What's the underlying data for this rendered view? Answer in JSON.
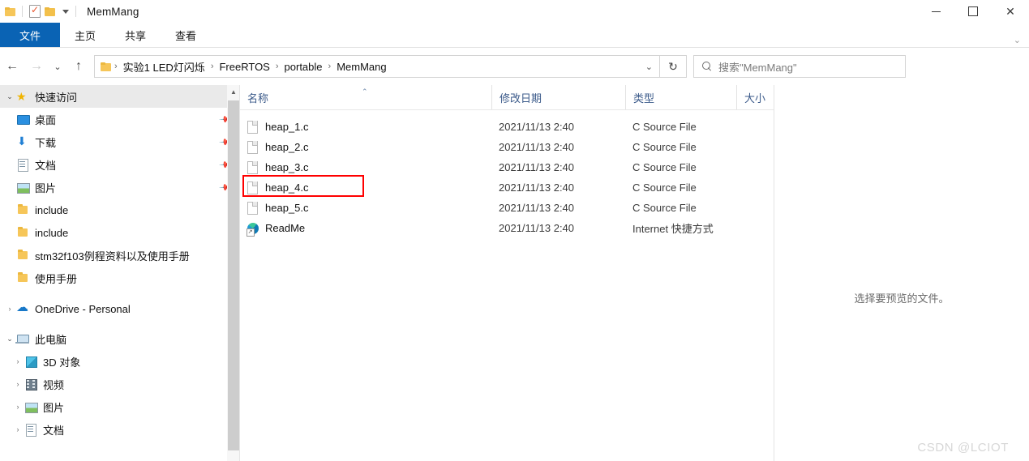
{
  "window": {
    "title": "MemMang",
    "controls": {
      "minimize": "—",
      "maximize": "▢",
      "close": "✕"
    },
    "quick_access": {
      "folder_icon": "folder-icon",
      "properties_icon": "properties-checkbox-icon",
      "new_folder_icon": "new-folder-icon",
      "dropdown_icon": "chevron-down-icon"
    }
  },
  "ribbon": {
    "tabs": [
      {
        "label": "文件",
        "active": true
      },
      {
        "label": "主页",
        "active": false
      },
      {
        "label": "共享",
        "active": false
      },
      {
        "label": "查看",
        "active": false
      }
    ],
    "expand_icon": "chevron-down-icon",
    "file_tab_color": "#0a63b4"
  },
  "navbar": {
    "back_icon": "arrow-left-icon",
    "forward_icon": "arrow-right-icon",
    "recent_icon": "chevron-down-icon",
    "up_icon": "arrow-up-icon",
    "refresh_icon": "refresh-icon",
    "address_dropdown_icon": "chevron-down-icon",
    "breadcrumbs": [
      "实验1 LED灯闪烁",
      "FreeRTOS",
      "portable",
      "MemMang"
    ],
    "separator": "›"
  },
  "search": {
    "placeholder": "搜索\"MemMang\"",
    "icon": "search-icon"
  },
  "sidebar": {
    "scrollbar": {
      "up_icon": "chevron-up-icon"
    },
    "groups": [
      {
        "label": "快速访问",
        "icon": "star-icon",
        "expanded": true,
        "chevron": "chevron-down-icon",
        "items": [
          {
            "label": "桌面",
            "icon": "desktop-icon",
            "pinned": true
          },
          {
            "label": "下载",
            "icon": "download-icon",
            "pinned": true
          },
          {
            "label": "文档",
            "icon": "documents-icon",
            "pinned": true
          },
          {
            "label": "图片",
            "icon": "pictures-icon",
            "pinned": true
          },
          {
            "label": "include",
            "icon": "folder-icon",
            "pinned": false
          },
          {
            "label": "include",
            "icon": "folder-icon",
            "pinned": false
          },
          {
            "label": "stm32f103例程资料以及使用手册",
            "icon": "folder-icon",
            "pinned": false
          },
          {
            "label": "使用手册",
            "icon": "folder-icon",
            "pinned": false
          }
        ]
      },
      {
        "label": "OneDrive - Personal",
        "icon": "cloud-icon",
        "expanded": false,
        "chevron": "chevron-right-icon",
        "items": []
      },
      {
        "label": "此电脑",
        "icon": "computer-icon",
        "expanded": true,
        "chevron": "chevron-down-icon",
        "items": [
          {
            "label": "3D 对象",
            "icon": "3d-objects-icon",
            "chevron": "chevron-right-icon"
          },
          {
            "label": "视频",
            "icon": "videos-icon",
            "chevron": "chevron-right-icon"
          },
          {
            "label": "图片",
            "icon": "pictures-icon",
            "chevron": "chevron-right-icon"
          },
          {
            "label": "文档",
            "icon": "documents-icon",
            "chevron": "chevron-right-icon"
          }
        ]
      }
    ]
  },
  "filelist": {
    "columns": {
      "name": "名称",
      "date": "修改日期",
      "type": "类型",
      "size": "大小"
    },
    "sort": {
      "column": "名称",
      "direction": "asc",
      "icon": "caret-up-icon"
    },
    "rows": [
      {
        "name": "heap_1.c",
        "date": "2021/11/13 2:40",
        "type": "C Source File",
        "size": "",
        "icon": "c-file-icon",
        "highlighted": false
      },
      {
        "name": "heap_2.c",
        "date": "2021/11/13 2:40",
        "type": "C Source File",
        "size": "",
        "icon": "c-file-icon",
        "highlighted": false
      },
      {
        "name": "heap_3.c",
        "date": "2021/11/13 2:40",
        "type": "C Source File",
        "size": "",
        "icon": "c-file-icon",
        "highlighted": false
      },
      {
        "name": "heap_4.c",
        "date": "2021/11/13 2:40",
        "type": "C Source File",
        "size": "",
        "icon": "c-file-icon",
        "highlighted": true
      },
      {
        "name": "heap_5.c",
        "date": "2021/11/13 2:40",
        "type": "C Source File",
        "size": "",
        "icon": "c-file-icon",
        "highlighted": false
      },
      {
        "name": "ReadMe",
        "date": "2021/11/13 2:40",
        "type": "Internet 快捷方式",
        "size": "",
        "icon": "edge-shortcut-icon",
        "highlighted": false
      }
    ],
    "highlight_color": "#ff0000"
  },
  "preview": {
    "empty_text": "选择要预览的文件。"
  },
  "watermark": "CSDN @LCIOT"
}
